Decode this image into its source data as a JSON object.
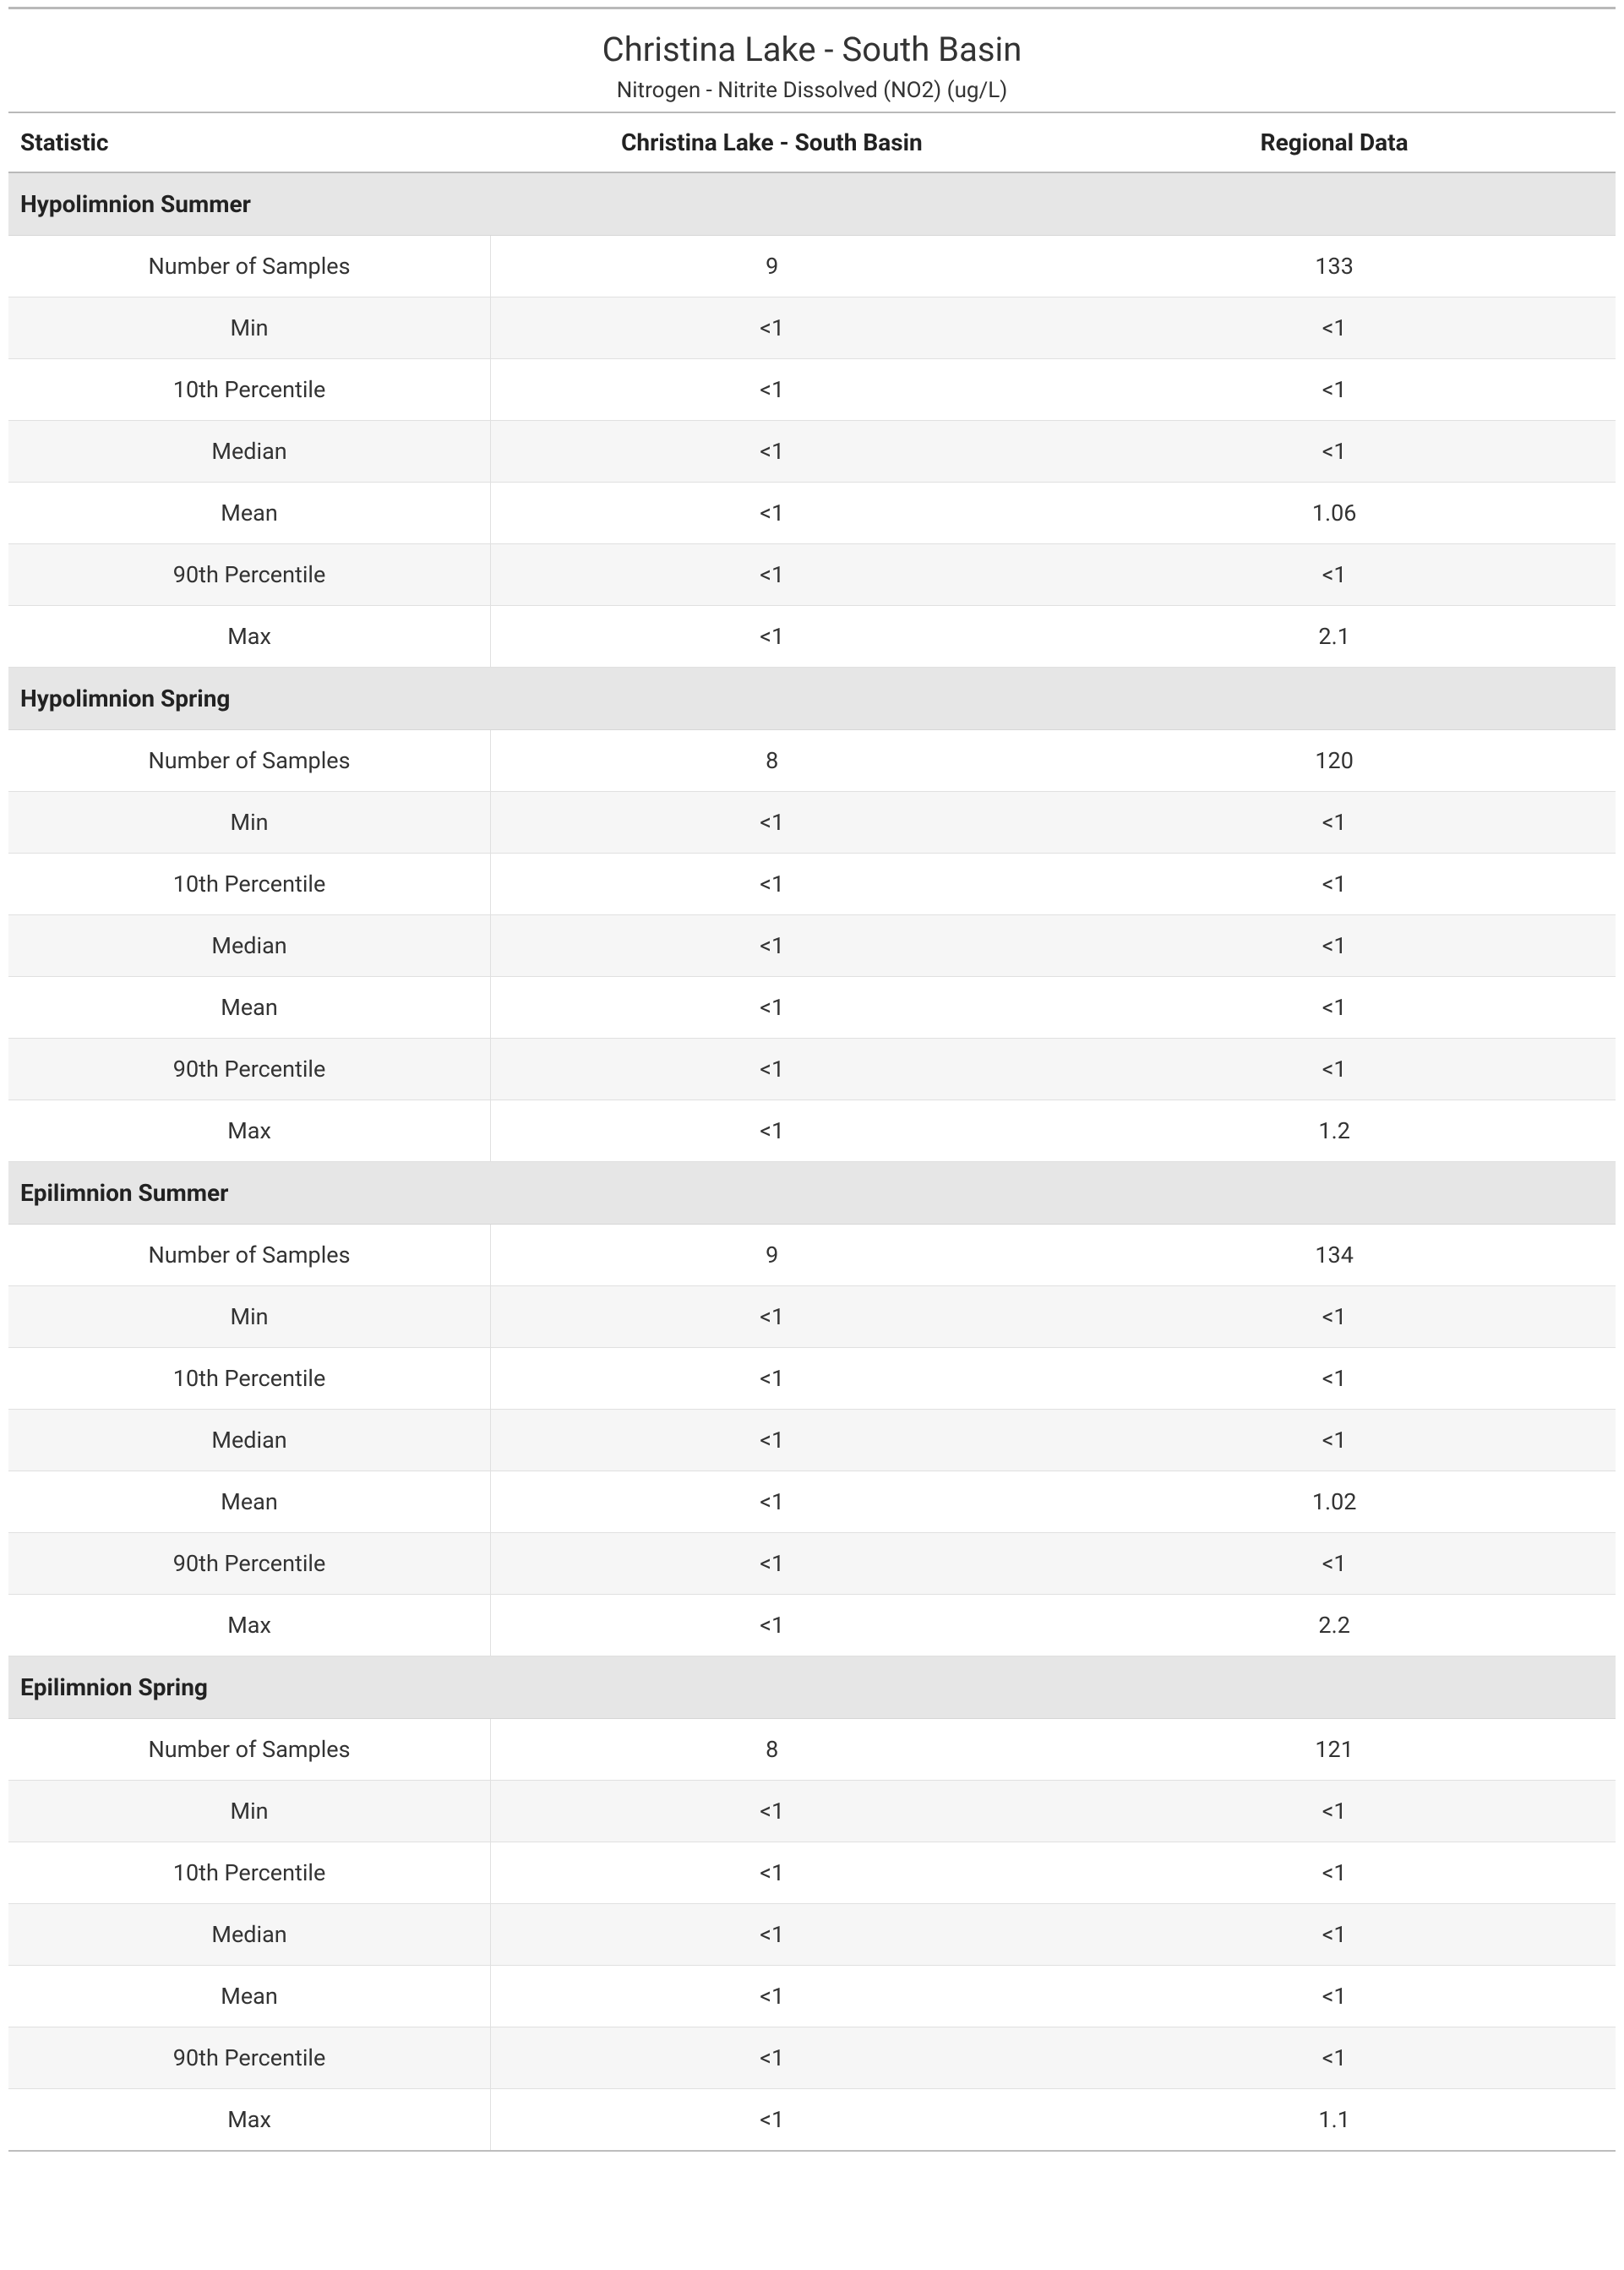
{
  "header": {
    "title": "Christina Lake - South Basin",
    "subtitle": "Nitrogen - Nitrite Dissolved (NO2) (ug/L)"
  },
  "columns": {
    "stat": "Statistic",
    "site": "Christina Lake - South Basin",
    "regional": "Regional Data"
  },
  "sections": [
    {
      "name": "Hypolimnion Summer",
      "rows": [
        {
          "stat": "Number of Samples",
          "site": "9",
          "regional": "133"
        },
        {
          "stat": "Min",
          "site": "<1",
          "regional": "<1"
        },
        {
          "stat": "10th Percentile",
          "site": "<1",
          "regional": "<1"
        },
        {
          "stat": "Median",
          "site": "<1",
          "regional": "<1"
        },
        {
          "stat": "Mean",
          "site": "<1",
          "regional": "1.06"
        },
        {
          "stat": "90th Percentile",
          "site": "<1",
          "regional": "<1"
        },
        {
          "stat": "Max",
          "site": "<1",
          "regional": "2.1"
        }
      ]
    },
    {
      "name": "Hypolimnion Spring",
      "rows": [
        {
          "stat": "Number of Samples",
          "site": "8",
          "regional": "120"
        },
        {
          "stat": "Min",
          "site": "<1",
          "regional": "<1"
        },
        {
          "stat": "10th Percentile",
          "site": "<1",
          "regional": "<1"
        },
        {
          "stat": "Median",
          "site": "<1",
          "regional": "<1"
        },
        {
          "stat": "Mean",
          "site": "<1",
          "regional": "<1"
        },
        {
          "stat": "90th Percentile",
          "site": "<1",
          "regional": "<1"
        },
        {
          "stat": "Max",
          "site": "<1",
          "regional": "1.2"
        }
      ]
    },
    {
      "name": "Epilimnion Summer",
      "rows": [
        {
          "stat": "Number of Samples",
          "site": "9",
          "regional": "134"
        },
        {
          "stat": "Min",
          "site": "<1",
          "regional": "<1"
        },
        {
          "stat": "10th Percentile",
          "site": "<1",
          "regional": "<1"
        },
        {
          "stat": "Median",
          "site": "<1",
          "regional": "<1"
        },
        {
          "stat": "Mean",
          "site": "<1",
          "regional": "1.02"
        },
        {
          "stat": "90th Percentile",
          "site": "<1",
          "regional": "<1"
        },
        {
          "stat": "Max",
          "site": "<1",
          "regional": "2.2"
        }
      ]
    },
    {
      "name": "Epilimnion Spring",
      "rows": [
        {
          "stat": "Number of Samples",
          "site": "8",
          "regional": "121"
        },
        {
          "stat": "Min",
          "site": "<1",
          "regional": "<1"
        },
        {
          "stat": "10th Percentile",
          "site": "<1",
          "regional": "<1"
        },
        {
          "stat": "Median",
          "site": "<1",
          "regional": "<1"
        },
        {
          "stat": "Mean",
          "site": "<1",
          "regional": "<1"
        },
        {
          "stat": "90th Percentile",
          "site": "<1",
          "regional": "<1"
        },
        {
          "stat": "Max",
          "site": "<1",
          "regional": "1.1"
        }
      ]
    }
  ]
}
